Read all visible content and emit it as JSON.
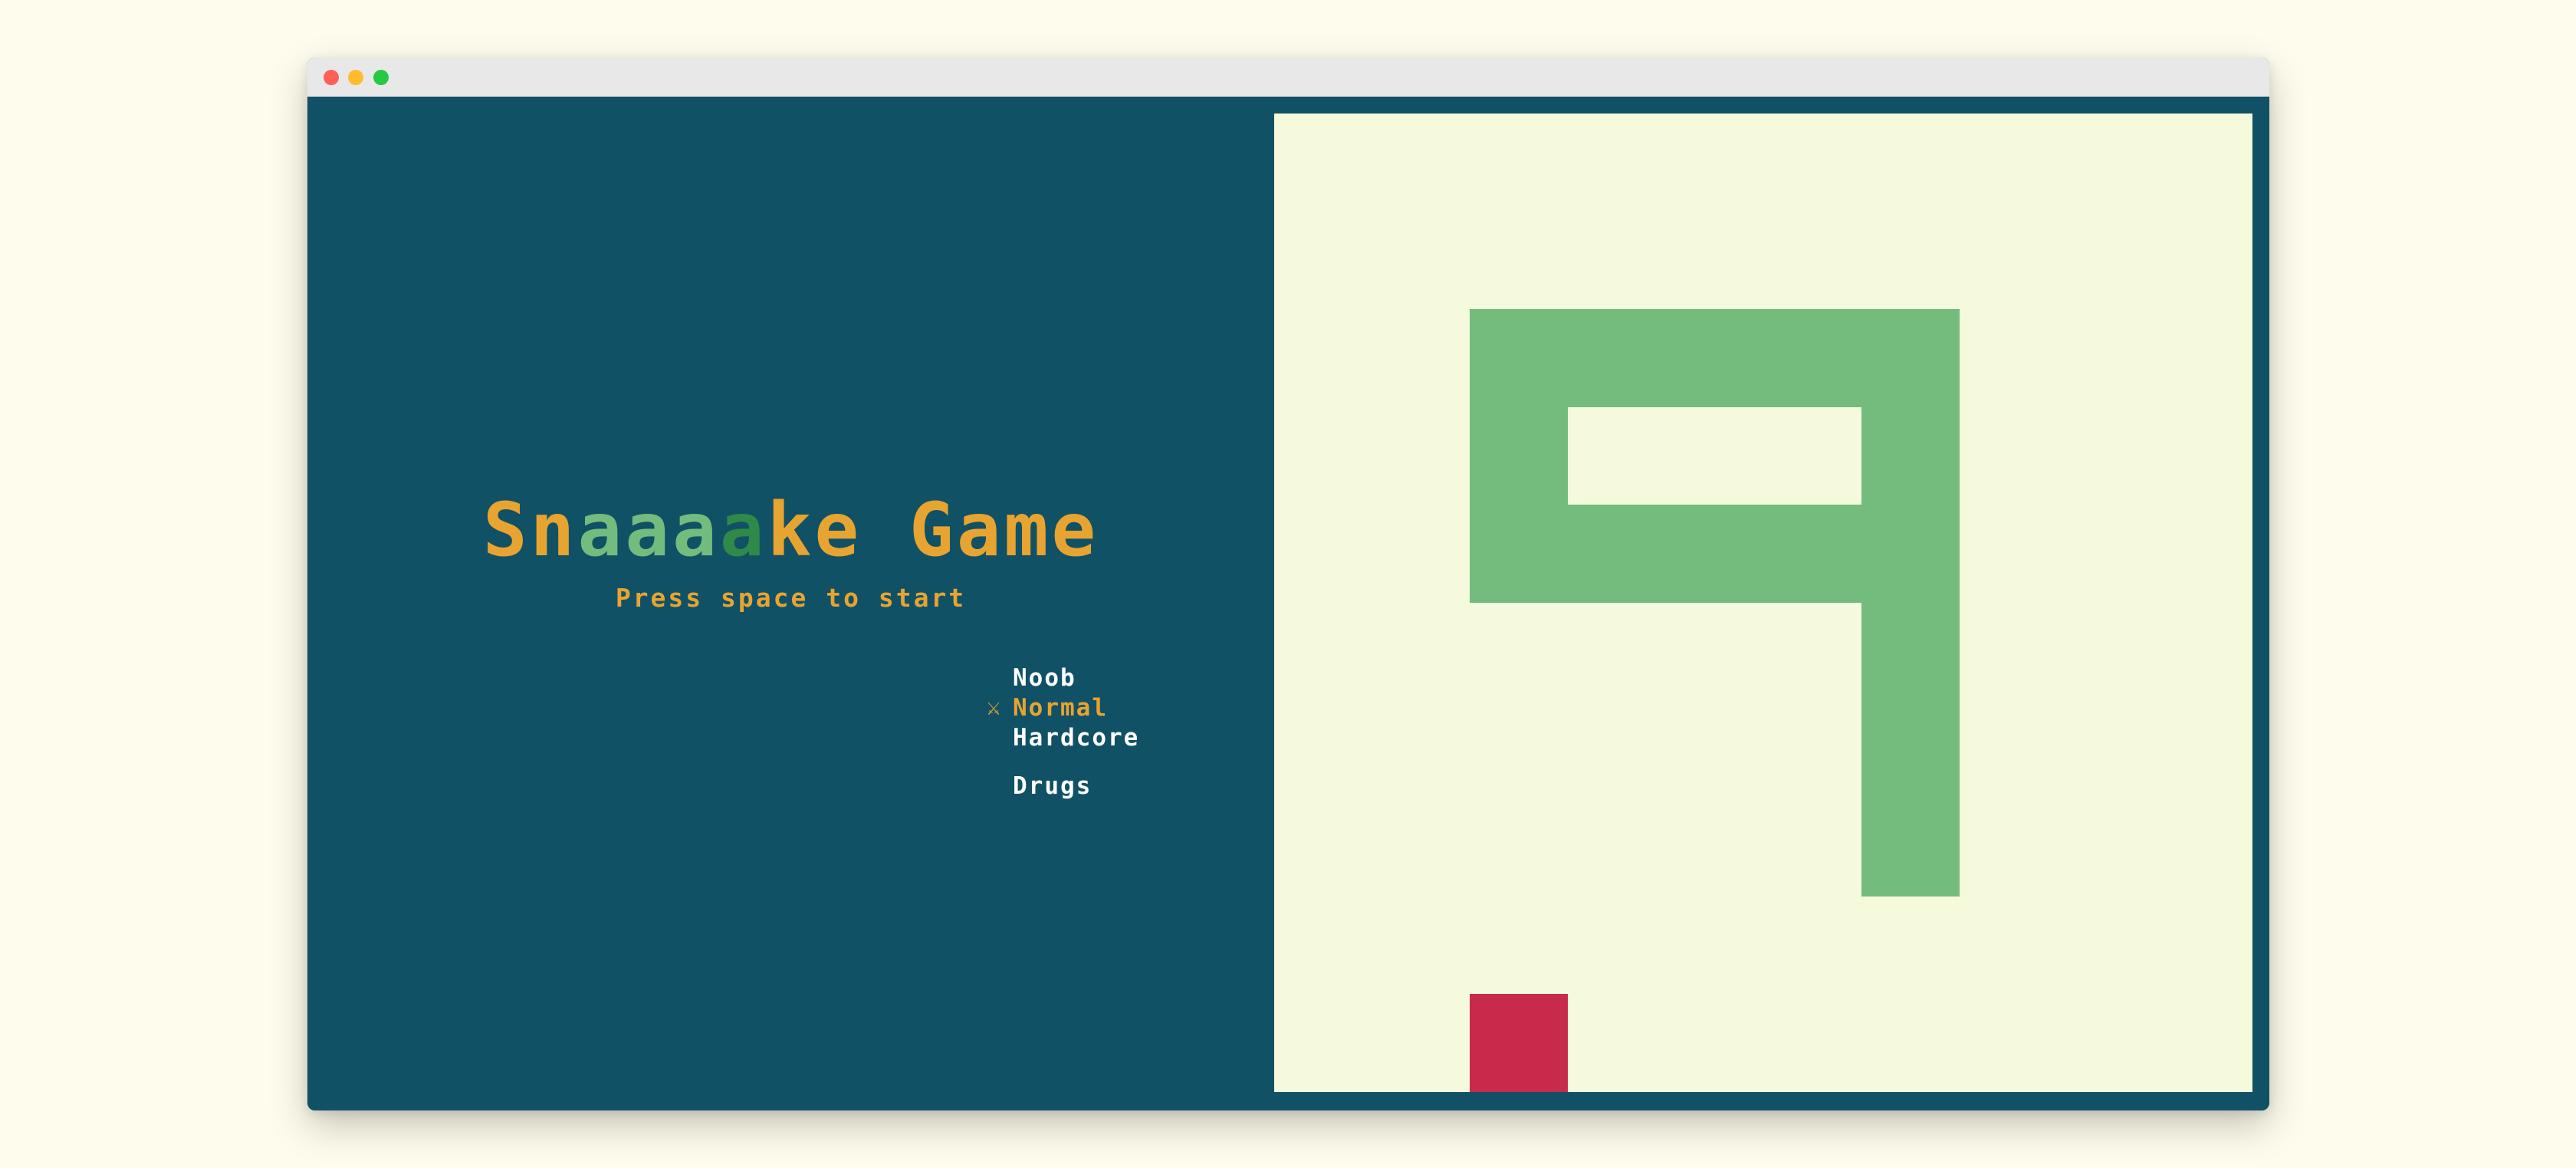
{
  "window": {
    "controls": [
      "close",
      "minimize",
      "maximize"
    ]
  },
  "menu": {
    "title_segments": [
      {
        "text": "Sn",
        "color": "#e8a430"
      },
      {
        "text": "aaa",
        "color": "#74bb7e"
      },
      {
        "text": "a",
        "color": "#2f8a49"
      },
      {
        "text": "ke Game",
        "color": "#e8a430"
      }
    ],
    "subtitle": "Press space to start",
    "difficulties": [
      {
        "label": "Noob",
        "selected": false
      },
      {
        "label": "Normal",
        "selected": true
      },
      {
        "label": "Hardcore",
        "selected": false
      },
      {
        "label": "Drugs",
        "selected": false
      }
    ],
    "selected_icon": "crossed-swords-icon",
    "selected_glyph": "⚔"
  },
  "board": {
    "grid_size": 10,
    "background_color": "#f4fadb",
    "snake_color": "#74bb7e",
    "food_color": "#c72a4b",
    "snake_cells": [
      [
        2,
        2
      ],
      [
        3,
        2
      ],
      [
        4,
        2
      ],
      [
        5,
        2
      ],
      [
        6,
        2
      ],
      [
        2,
        3
      ],
      [
        6,
        3
      ],
      [
        2,
        4
      ],
      [
        3,
        4
      ],
      [
        4,
        4
      ],
      [
        5,
        4
      ],
      [
        6,
        4
      ],
      [
        6,
        5
      ],
      [
        6,
        6
      ],
      [
        6,
        7
      ]
    ],
    "food_cell": [
      2,
      9
    ]
  },
  "colors": {
    "window_background": "#115166",
    "accent": "#e8a430",
    "text": "#ffffff",
    "titlebar": "#e8e8e8"
  }
}
